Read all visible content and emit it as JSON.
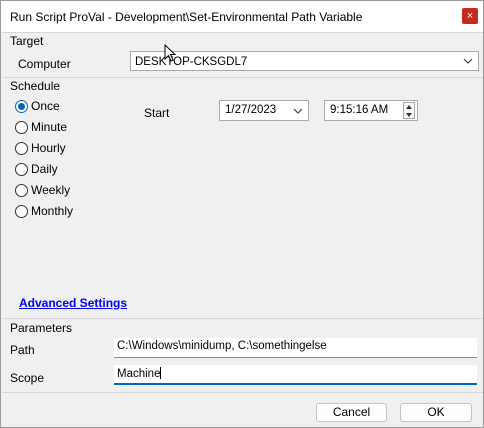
{
  "window": {
    "title": "Run Script ProVal - Development\\Set-Environmental Path Variable",
    "close_glyph": "×"
  },
  "target": {
    "group_label": "Target",
    "computer_label": "Computer",
    "computer_value": "DESKTOP-CKSGDL7"
  },
  "schedule": {
    "group_label": "Schedule",
    "options": [
      {
        "label": "Once",
        "checked": true
      },
      {
        "label": "Minute",
        "checked": false
      },
      {
        "label": "Hourly",
        "checked": false
      },
      {
        "label": "Daily",
        "checked": false
      },
      {
        "label": "Weekly",
        "checked": false
      },
      {
        "label": "Monthly",
        "checked": false
      }
    ],
    "start_label": "Start",
    "start_date": "1/27/2023",
    "start_time": "9:15:16 AM"
  },
  "advanced_settings_label": "Advanced Settings",
  "parameters": {
    "group_label": "Parameters",
    "path_label": "Path",
    "path_value": "C:\\Windows\\minidump, C:\\somethingelse",
    "scope_label": "Scope",
    "scope_value": "Machine"
  },
  "buttons": {
    "cancel": "Cancel",
    "ok": "OK"
  },
  "colors": {
    "accent": "#0067c0",
    "close": "#c42b1c",
    "link": "#0000ff"
  },
  "icons": [
    "close-icon",
    "chevron-down-icon",
    "radio-icon",
    "spin-up-icon",
    "spin-down-icon",
    "mouse-pointer-icon"
  ]
}
